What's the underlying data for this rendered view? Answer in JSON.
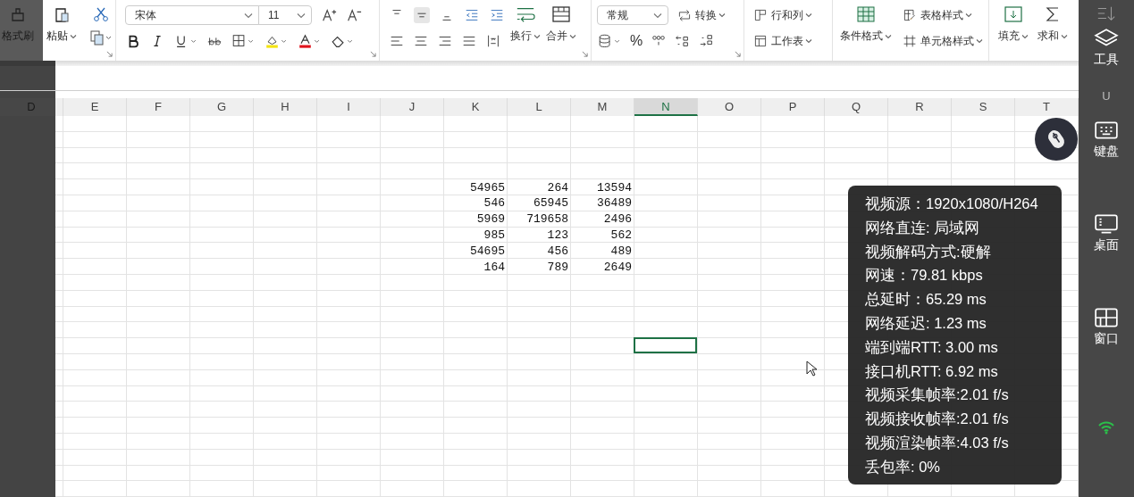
{
  "ribbon": {
    "clipboard": {
      "format_painter": "格式刷",
      "paste": "粘贴"
    },
    "font": {
      "family": "宋体",
      "size": "11"
    },
    "alignment": {
      "vertical": [
        {
          "selected": false
        },
        {
          "selected": true
        },
        {
          "selected": false
        }
      ],
      "wrap": "换行",
      "merge": "合并"
    },
    "number": {
      "format": "常规",
      "convert": "转换",
      "percent": "%"
    },
    "cells": {
      "rows_columns": "行和列",
      "worksheet": "工作表"
    },
    "styles": {
      "conditional": "条件格式",
      "table_style": "表格样式",
      "cell_style": "单元格样式"
    },
    "editing": {
      "fill": "填充",
      "sum": "求和"
    }
  },
  "sheet": {
    "columns": [
      {
        "label": "D",
        "selected": false
      },
      {
        "label": "E",
        "selected": false
      },
      {
        "label": "F",
        "selected": false
      },
      {
        "label": "G",
        "selected": false
      },
      {
        "label": "H",
        "selected": false
      },
      {
        "label": "I",
        "selected": false
      },
      {
        "label": "J",
        "selected": false
      },
      {
        "label": "K",
        "selected": false
      },
      {
        "label": "L",
        "selected": false
      },
      {
        "label": "M",
        "selected": false
      },
      {
        "label": "N",
        "selected": true
      },
      {
        "label": "O",
        "selected": false
      },
      {
        "label": "P",
        "selected": false
      },
      {
        "label": "Q",
        "selected": false
      },
      {
        "label": "R",
        "selected": false
      },
      {
        "label": "S",
        "selected": false
      },
      {
        "label": "T",
        "selected": false
      },
      {
        "label": "U",
        "selected": false
      }
    ],
    "data": [
      [
        "54965",
        "264",
        "13594"
      ],
      [
        "546",
        "65945",
        "36489"
      ],
      [
        "5969",
        "719658",
        "2496"
      ],
      [
        "985",
        "123",
        "562"
      ],
      [
        "54695",
        "456",
        "489"
      ],
      [
        "164",
        "789",
        "2649"
      ]
    ]
  },
  "stats": [
    "视频源：1920x1080/H264",
    "网络直连: 局域网",
    "视频解码方式:硬解",
    "网速：79.81 kbps",
    "总延时：65.29 ms",
    "网络延迟: 1.23 ms",
    "端到端RTT: 3.00 ms",
    "接口机RTT: 6.92 ms",
    "视频采集帧率:2.01 f/s",
    "视频接收帧率:2.01 f/s",
    "视频渲染帧率:4.03 f/s",
    "丢包率: 0%"
  ],
  "sidebar": [
    {
      "kind": "tools",
      "label": "工具"
    },
    {
      "kind": "keyboard",
      "label": "键盘"
    },
    {
      "kind": "desktop",
      "label": "桌面"
    },
    {
      "kind": "window",
      "label": "窗口"
    }
  ]
}
